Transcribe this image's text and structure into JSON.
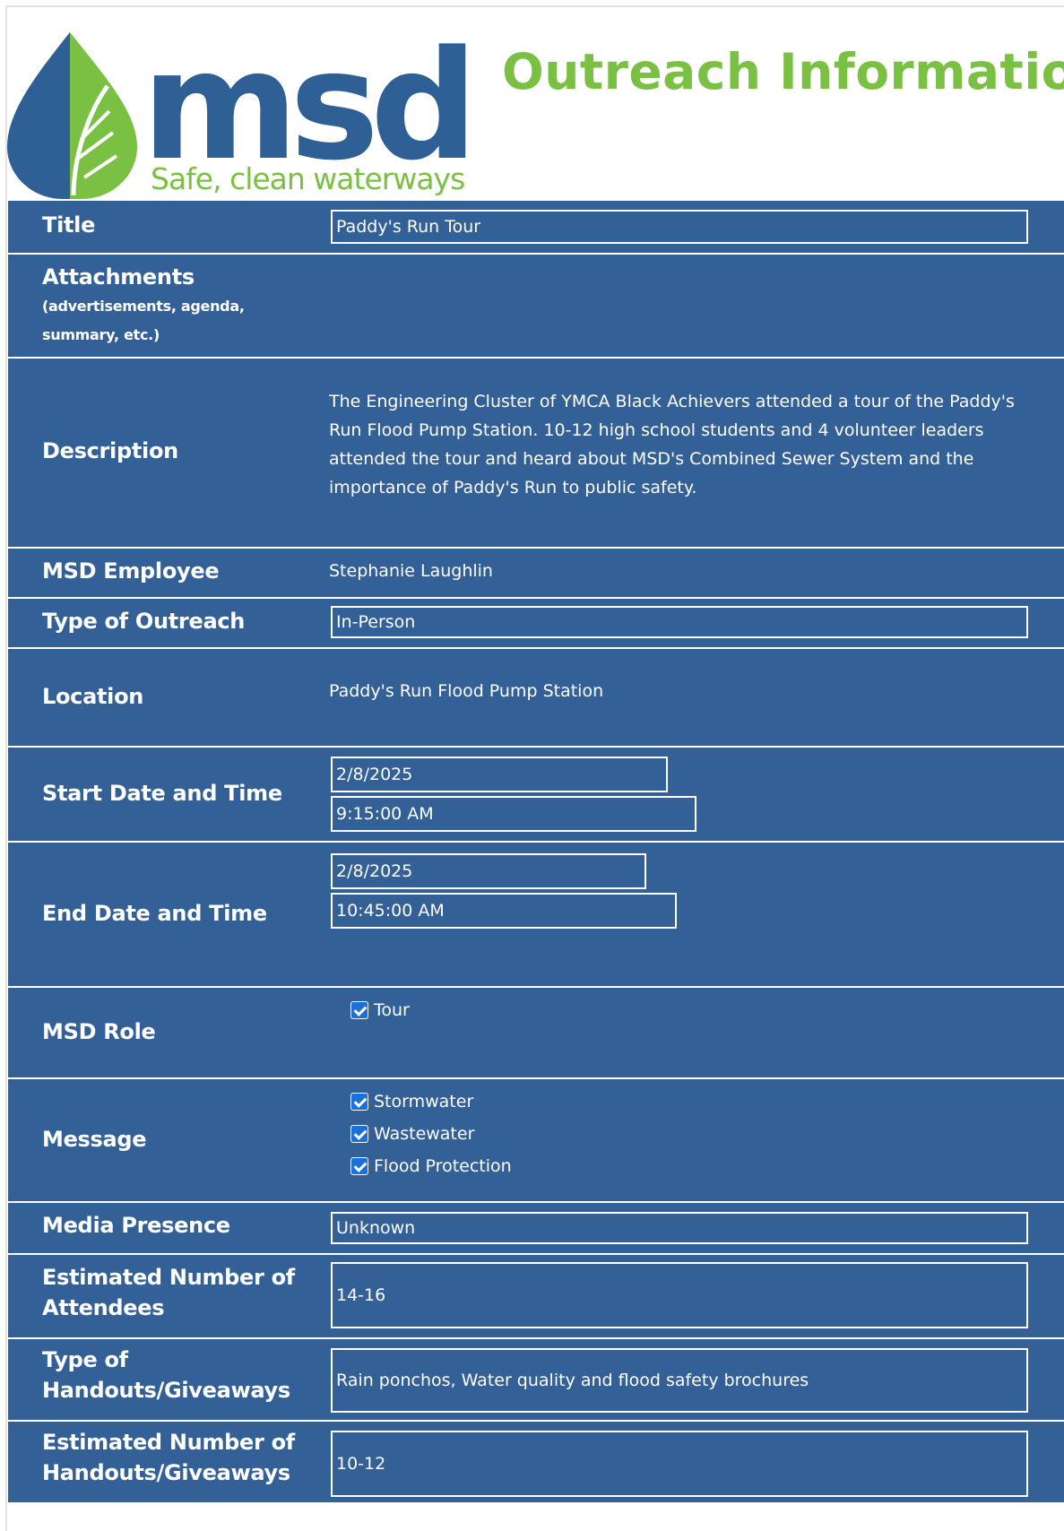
{
  "header": {
    "logo_word": "msd",
    "tagline": "Safe, clean waterways",
    "title": "Outreach Information"
  },
  "colors": {
    "form_bg": "#336097",
    "title_green": "#7ac143",
    "logo_blue": "#2e5f95",
    "logo_green": "#7ac143"
  },
  "form": {
    "title": {
      "label": "Title",
      "value": "Paddy's Run Tour"
    },
    "attachments": {
      "label": "Attachments",
      "sublabel": "(advertisements, agenda, summary, etc.)"
    },
    "description": {
      "label": "Description",
      "value": "The Engineering Cluster of YMCA Black Achievers attended a tour of the Paddy's Run Flood Pump Station. 10-12 high school students and 4 volunteer leaders attended the tour and heard about MSD's Combined Sewer System and the importance of Paddy's Run to public safety."
    },
    "employee": {
      "label": "MSD Employee",
      "value": "Stephanie Laughlin"
    },
    "outreach_type": {
      "label": "Type of Outreach",
      "value": "In-Person"
    },
    "location": {
      "label": "Location",
      "value": "Paddy's Run Flood Pump Station"
    },
    "start": {
      "label": "Start Date and Time",
      "date": "2/8/2025",
      "time": "9:15:00 AM"
    },
    "end": {
      "label": "End Date and Time",
      "date": "2/8/2025",
      "time": "10:45:00 AM"
    },
    "role": {
      "label": "MSD Role",
      "options": [
        {
          "label": "Tour",
          "checked": true
        }
      ]
    },
    "message": {
      "label": "Message",
      "options": [
        {
          "label": "Stormwater",
          "checked": true
        },
        {
          "label": "Wastewater",
          "checked": true
        },
        {
          "label": "Flood Protection",
          "checked": true
        }
      ]
    },
    "media": {
      "label": "Media Presence",
      "value": "Unknown"
    },
    "attendees": {
      "label": "Estimated Number of Attendees",
      "value": "14-16"
    },
    "handout_type": {
      "label": "Type of Handouts/Giveaways",
      "value": "Rain ponchos, Water quality and flood safety brochures"
    },
    "handout_count": {
      "label": "Estimated Number of Handouts/Giveaways",
      "value": "10-12"
    }
  }
}
